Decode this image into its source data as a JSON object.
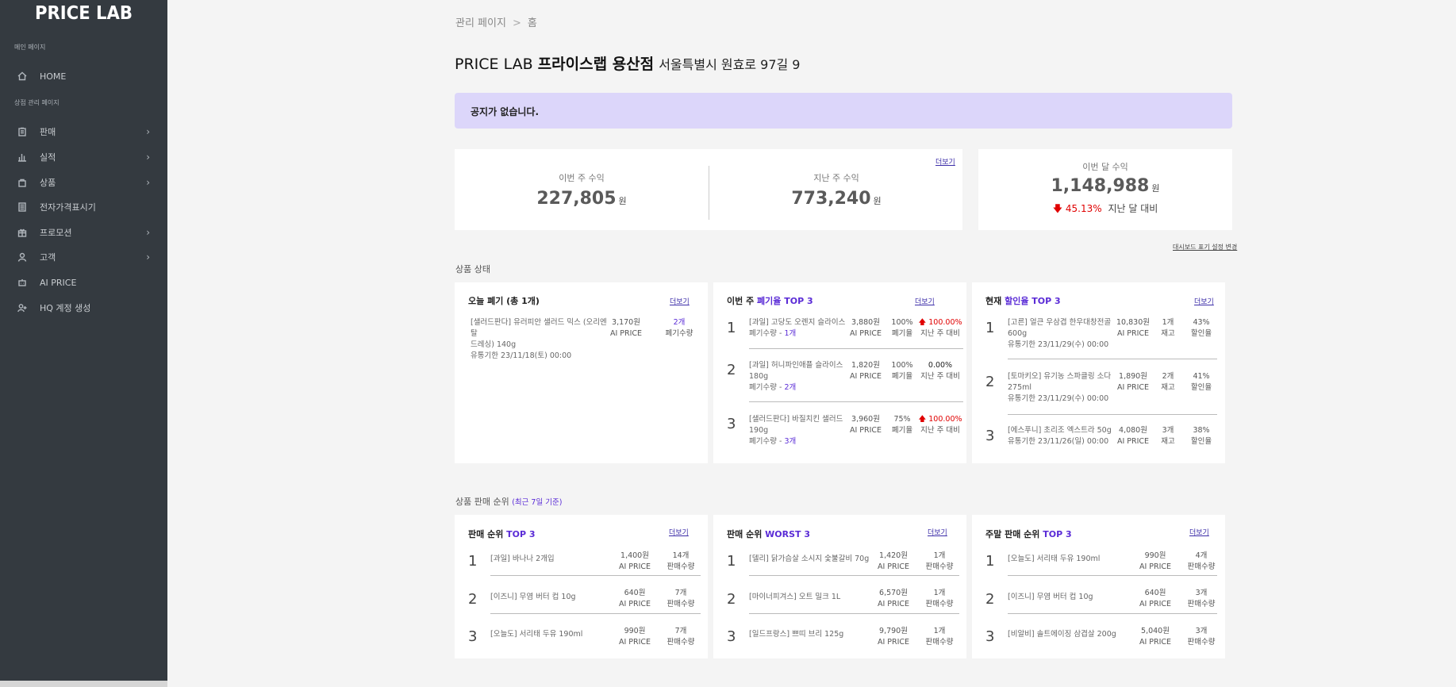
{
  "app": {
    "logo": "PRICE LAB"
  },
  "sidebar": {
    "section_main": "메인 페이지",
    "section_store": "상점 관리 페이지",
    "items": [
      {
        "label": "HOME",
        "icon": "home-icon"
      },
      {
        "label": "판매",
        "icon": "clipboard-icon",
        "has_sub": true
      },
      {
        "label": "실적",
        "icon": "bar-chart-icon",
        "has_sub": true
      },
      {
        "label": "상품",
        "icon": "bag-icon",
        "has_sub": true
      },
      {
        "label": "전자가격표시기",
        "icon": "calculator-icon"
      },
      {
        "label": "프로모션",
        "icon": "gift-icon",
        "has_sub": true
      },
      {
        "label": "고객",
        "icon": "user-icon",
        "has_sub": true
      },
      {
        "label": "AI PRICE",
        "icon": "robot-icon"
      },
      {
        "label": "HQ 계정 생성",
        "icon": "user-add-icon"
      }
    ]
  },
  "breadcrumb": {
    "root": "관리 페이지",
    "current": "홈"
  },
  "header": {
    "brand": "PRICE LAB",
    "store": "프라이스랩 용산점",
    "address": "서울특별시 원효로 97길 9"
  },
  "notice": "공지가 없습니다.",
  "more_label": "더보기",
  "income": {
    "this_week_label": "이번 주 수익",
    "this_week_value": "227,805",
    "last_week_label": "지난 주 수익",
    "last_week_value": "773,240",
    "this_month_label": "이번 달 수익",
    "this_month_value": "1,148,988",
    "unit": "원",
    "change_arrow": "🡇",
    "change_pct": "45.13%",
    "change_label": "지난 달 대비"
  },
  "dashboard_settings_link": "대시보드 표기 설정 변경",
  "product_status": {
    "section": "상품 상태",
    "disposal": {
      "title": "오늘 폐기 (총 1개)",
      "items": [
        {
          "name_line1": "[샐러드판다] 유러피안 샐러드 믹스 (오리엔탈",
          "name_line2": "드레싱) 140g",
          "expiry": "유통기한 23/11/18(토) 00:00",
          "price": "3,170원",
          "price_label": "AI PRICE",
          "qty": "2개",
          "qty_label": "폐기수량"
        }
      ]
    },
    "disposal_rate": {
      "title_prefix": "이번 주 ",
      "title_hl": "폐기율 TOP 3",
      "rows": [
        {
          "rank": "1",
          "name_line1": "[과일] 고당도 오렌지 슬라이스",
          "sub_prefix": "폐기수량 - ",
          "sub_val": "1개",
          "price": "3,880원",
          "price_label": "AI PRICE",
          "rate": "100%",
          "rate_label": "폐기율",
          "change": "100.00%",
          "up": true,
          "change_label": "지난 주 대비"
        },
        {
          "rank": "2",
          "name_line1": "[과일] 허니파인애플 슬라이스",
          "name_line2": "180g",
          "sub_prefix": "폐기수량 - ",
          "sub_val": "2개",
          "price": "1,820원",
          "price_label": "AI PRICE",
          "rate": "100%",
          "rate_label": "폐기율",
          "change": "0.00%",
          "up": false,
          "change_label": "지난 주 대비"
        },
        {
          "rank": "3",
          "name_line1": "[샐러드판다] 바질치킨 샐러드",
          "name_line2": "190g",
          "sub_prefix": "폐기수량 - ",
          "sub_val": "3개",
          "price": "3,960원",
          "price_label": "AI PRICE",
          "rate": "75%",
          "rate_label": "폐기율",
          "change": "100.00%",
          "up": true,
          "change_label": "지난 주 대비"
        }
      ]
    },
    "discount": {
      "title_prefix": "현재 ",
      "title_hl": "할인율 TOP 3",
      "rows": [
        {
          "rank": "1",
          "name_line1": "[고른] 얼큰 우삼겹 한우대창전골",
          "name_line2": "600g",
          "expiry": "유통기한 23/11/29(수) 00:00",
          "price": "10,830원",
          "price_label": "AI PRICE",
          "stock": "1개",
          "stock_label": "재고",
          "rate": "43%",
          "rate_label": "할인율"
        },
        {
          "rank": "2",
          "name_line1": "[토마키오] 유기농 스파클링 소다",
          "name_line2": "275ml",
          "expiry": "유통기한 23/11/29(수) 00:00",
          "price": "1,890원",
          "price_label": "AI PRICE",
          "stock": "2개",
          "stock_label": "재고",
          "rate": "41%",
          "rate_label": "할인율"
        },
        {
          "rank": "3",
          "name_line1": "[에스푸니] 초리조 엑스트라 50g",
          "expiry": "유통기한 23/11/26(일) 00:00",
          "price": "4,080원",
          "price_label": "AI PRICE",
          "stock": "3개",
          "stock_label": "재고",
          "rate": "38%",
          "rate_label": "할인율"
        }
      ]
    }
  },
  "sales_rank": {
    "section": "상품 판매 순위",
    "section_hl": "(최근 7일 기준)",
    "panels": [
      {
        "title_prefix": "판매 순위 ",
        "title_hl": "TOP 3",
        "rows": [
          {
            "rank": "1",
            "name": "[과일] 바나나 2개입",
            "price": "1,400원",
            "qty": "14개"
          },
          {
            "rank": "2",
            "name": "[이즈니] 무염 버터 컵 10g",
            "price": "640원",
            "qty": "7개"
          },
          {
            "rank": "3",
            "name": "[오늘도] 서리태 두유 190ml",
            "price": "990원",
            "qty": "7개"
          }
        ]
      },
      {
        "title_prefix": "판매 순위 ",
        "title_hl": "WORST 3",
        "rows": [
          {
            "rank": "1",
            "name": "[델리] 닭가슴살 소시지 숯불갈비 70g",
            "price": "1,420원",
            "qty": "1개"
          },
          {
            "rank": "2",
            "name": "[마이너피겨스] 오트 밀크 1L",
            "price": "6,570원",
            "qty": "1개"
          },
          {
            "rank": "3",
            "name": "[일드프랑스] 쁘띠 브리 125g",
            "price": "9,790원",
            "qty": "1개"
          }
        ]
      },
      {
        "title_prefix": "주말 판매 순위 ",
        "title_hl": "TOP 3",
        "rows": [
          {
            "rank": "1",
            "name": "[오늘도] 서리태 두유 190ml",
            "price": "990원",
            "qty": "4개"
          },
          {
            "rank": "2",
            "name": "[이즈니] 무염 버터 컵 10g",
            "price": "640원",
            "qty": "3개"
          },
          {
            "rank": "3",
            "name": "[비알비] 솔트에이징 삼겹살 200g",
            "price": "5,040원",
            "qty": "3개"
          }
        ]
      }
    ],
    "price_label": "AI PRICE",
    "qty_label": "판매수량"
  },
  "colors": {
    "sidebar": "#343a40",
    "accent": "#5a2bd6",
    "notice_bg": "#dcd6fa",
    "down": "#e00000"
  }
}
